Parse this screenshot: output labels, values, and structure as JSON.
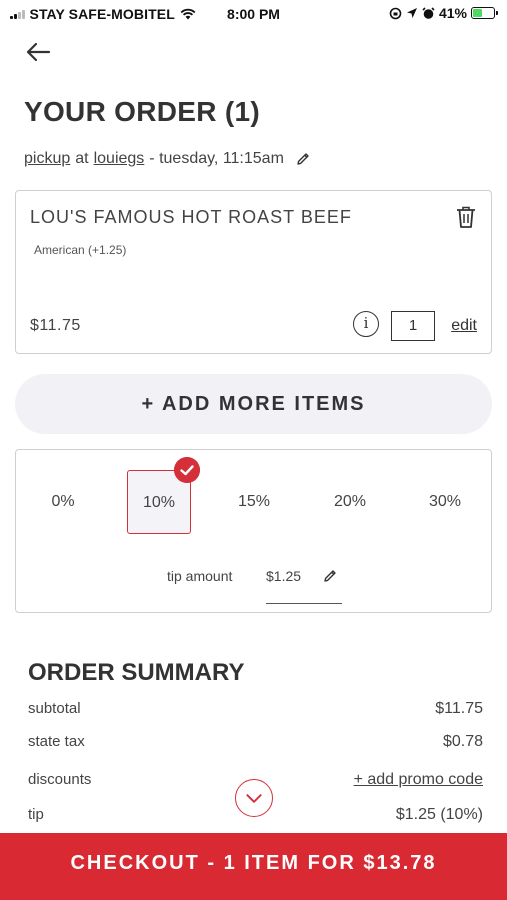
{
  "status_bar": {
    "carrier": "STAY SAFE-MOBITEL",
    "time": "8:00 PM",
    "battery": "41%",
    "battery_level": 0.41
  },
  "header": {
    "title": "YOUR ORDER (1)",
    "pickup_label": "pickup",
    "at_text": "at",
    "location": "louiegs",
    "time_text": "- tuesday, 11:15am"
  },
  "order_item": {
    "name": "LOU'S FAMOUS HOT ROAST BEEF",
    "modifier": "American (+1.25)",
    "price": "$11.75",
    "info_glyph": "i",
    "quantity": "1",
    "edit_label": "edit"
  },
  "add_more_label": "+ ADD MORE ITEMS",
  "tip": {
    "options": [
      "0%",
      "10%",
      "15%",
      "20%",
      "30%"
    ],
    "selected": "10%",
    "amount_label": "tip amount",
    "amount_value": "$1.25"
  },
  "summary": {
    "title": "ORDER SUMMARY",
    "subtotal_label": "subtotal",
    "subtotal_value": "$11.75",
    "tax_label": "state tax",
    "tax_value": "$0.78",
    "discounts_label": "discounts",
    "promo_label": "+ add promo code",
    "tip_label": "tip",
    "tip_value": "$1.25 (10%)"
  },
  "checkout_label": "CHECKOUT - 1 ITEM FOR $13.78",
  "colors": {
    "accent": "#d92a33",
    "button_bg": "#f2f1f6",
    "text": "#333333"
  },
  "icons": [
    "signal-icon",
    "wifi-icon",
    "location-icon",
    "alarm-icon",
    "battery-icon",
    "back-arrow-icon",
    "pencil-icon",
    "trash-icon",
    "info-icon",
    "check-icon",
    "chevron-down-icon"
  ]
}
